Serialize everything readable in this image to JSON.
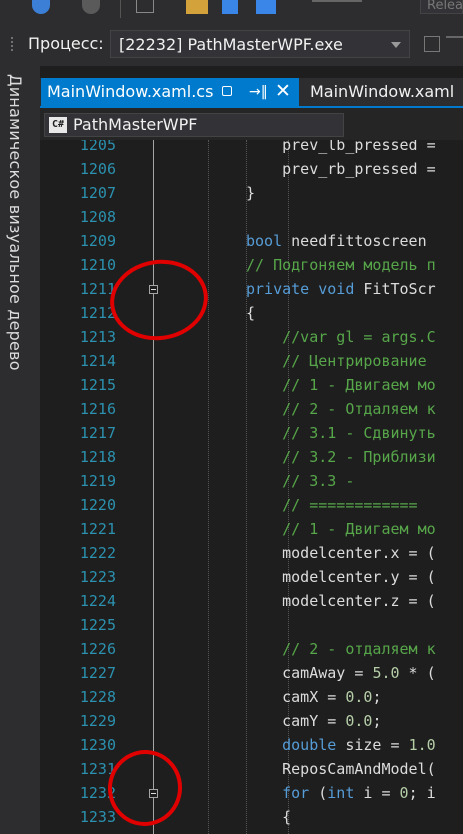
{
  "toolbar": {
    "config_value": "Release"
  },
  "process_bar": {
    "label": "Процесс:",
    "value": "[22232] PathMasterWPF.exe"
  },
  "side_panel": {
    "live_visual_tree": "Динамическое визуальное дерево"
  },
  "tabs": [
    {
      "label": "MainWindow.xaml.cs",
      "active": true
    },
    {
      "label": "MainWindow.xaml",
      "active": false
    }
  ],
  "nav": {
    "project": "PathMasterWPF"
  },
  "editor": {
    "lines": [
      {
        "num": "1205",
        "tokens": [
          {
            "t": "    prev_lb_pressed =",
            "c": "pl"
          }
        ]
      },
      {
        "num": "1206",
        "tokens": [
          {
            "t": "    prev_rb_pressed =",
            "c": "pl"
          }
        ]
      },
      {
        "num": "1207",
        "tokens": [
          {
            "t": "}",
            "c": "pl"
          }
        ]
      },
      {
        "num": "1208",
        "tokens": []
      },
      {
        "num": "1209",
        "tokens": [
          {
            "t": "bool",
            "c": "kw"
          },
          {
            "t": " needfittoscreen",
            "c": "pl"
          }
        ]
      },
      {
        "num": "1210",
        "tokens": [
          {
            "t": "// Подгоняем модель п",
            "c": "cm"
          }
        ]
      },
      {
        "num": "1211",
        "tokens": [
          {
            "t": "private",
            "c": "kw"
          },
          {
            "t": " ",
            "c": "pl"
          },
          {
            "t": "void",
            "c": "kw"
          },
          {
            "t": " FitToScr",
            "c": "pl"
          }
        ]
      },
      {
        "num": "1212",
        "tokens": [
          {
            "t": "{",
            "c": "pl"
          }
        ]
      },
      {
        "num": "1213",
        "tokens": [
          {
            "t": "    //var gl = args.C",
            "c": "cm"
          }
        ]
      },
      {
        "num": "1214",
        "tokens": [
          {
            "t": "    // Центрирование",
            "c": "cm"
          }
        ]
      },
      {
        "num": "1215",
        "tokens": [
          {
            "t": "    // 1 - Двигаем мо",
            "c": "cm"
          }
        ]
      },
      {
        "num": "1216",
        "tokens": [
          {
            "t": "    // 2 - Отдаляем к",
            "c": "cm"
          }
        ]
      },
      {
        "num": "1217",
        "tokens": [
          {
            "t": "    // 3.1 - Сдвинуть",
            "c": "cm"
          }
        ]
      },
      {
        "num": "1218",
        "tokens": [
          {
            "t": "    // 3.2 - Приблизи",
            "c": "cm"
          }
        ]
      },
      {
        "num": "1219",
        "tokens": [
          {
            "t": "    // 3.3 -",
            "c": "cm"
          }
        ]
      },
      {
        "num": "1220",
        "tokens": [
          {
            "t": "    // ============",
            "c": "cm"
          }
        ]
      },
      {
        "num": "1221",
        "tokens": [
          {
            "t": "    // 1 - Двигаем мо",
            "c": "cm"
          }
        ]
      },
      {
        "num": "1222",
        "tokens": [
          {
            "t": "    modelcenter.x = (",
            "c": "pl"
          }
        ]
      },
      {
        "num": "1223",
        "tokens": [
          {
            "t": "    modelcenter.y = (",
            "c": "pl"
          }
        ]
      },
      {
        "num": "1224",
        "tokens": [
          {
            "t": "    modelcenter.z = (",
            "c": "pl"
          }
        ]
      },
      {
        "num": "1225",
        "tokens": []
      },
      {
        "num": "1226",
        "tokens": [
          {
            "t": "    // 2 - отдаляем к",
            "c": "cm"
          }
        ]
      },
      {
        "num": "1227",
        "tokens": [
          {
            "t": "    camAway = ",
            "c": "pl"
          },
          {
            "t": "5.0",
            "c": "num"
          },
          {
            "t": " * (",
            "c": "pl"
          }
        ]
      },
      {
        "num": "1228",
        "tokens": [
          {
            "t": "    camX = ",
            "c": "pl"
          },
          {
            "t": "0.0",
            "c": "num"
          },
          {
            "t": ";",
            "c": "pl"
          }
        ]
      },
      {
        "num": "1229",
        "tokens": [
          {
            "t": "    camY = ",
            "c": "pl"
          },
          {
            "t": "0.0",
            "c": "num"
          },
          {
            "t": ";",
            "c": "pl"
          }
        ]
      },
      {
        "num": "1230",
        "tokens": [
          {
            "t": "    ",
            "c": "pl"
          },
          {
            "t": "double",
            "c": "kw"
          },
          {
            "t": " size = ",
            "c": "pl"
          },
          {
            "t": "1.0",
            "c": "num"
          }
        ]
      },
      {
        "num": "1231",
        "tokens": [
          {
            "t": "    ReposCamAndModel(",
            "c": "pl"
          }
        ]
      },
      {
        "num": "1232",
        "tokens": [
          {
            "t": "    ",
            "c": "pl"
          },
          {
            "t": "for",
            "c": "kw"
          },
          {
            "t": " (",
            "c": "pl"
          },
          {
            "t": "int",
            "c": "kw"
          },
          {
            "t": " i = ",
            "c": "pl"
          },
          {
            "t": "0",
            "c": "num"
          },
          {
            "t": "; i",
            "c": "pl"
          }
        ]
      },
      {
        "num": "1233",
        "tokens": [
          {
            "t": "    {",
            "c": "pl"
          }
        ]
      }
    ]
  }
}
